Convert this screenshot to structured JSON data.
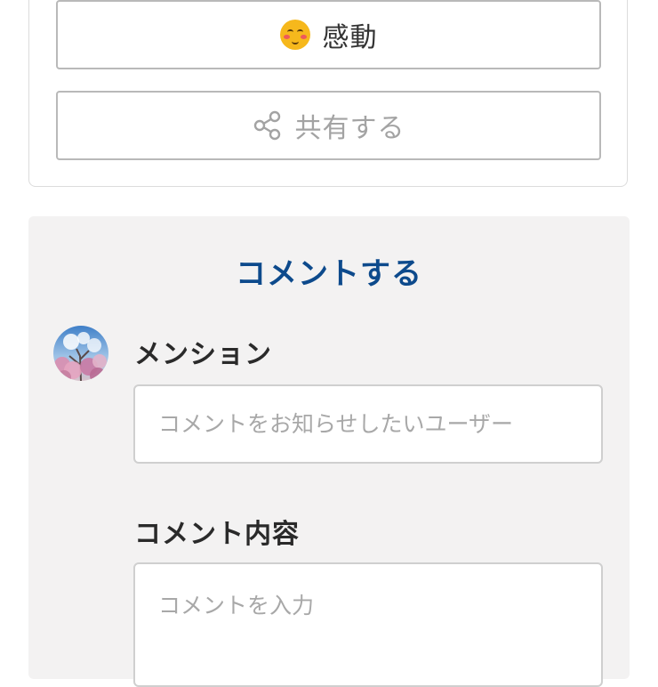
{
  "reaction_button": {
    "icon": "blushing-smile-emoji-icon",
    "label": "感動"
  },
  "share_button": {
    "icon": "share-icon",
    "label": "共有する"
  },
  "comment_section": {
    "title": "コメントする",
    "mention": {
      "label": "メンション",
      "placeholder": "コメントをお知らせしたいユーザー"
    },
    "content": {
      "label": "コメント内容",
      "placeholder": "コメントを入力"
    }
  },
  "colors": {
    "accent": "#0d4a8c",
    "panel_background": "#f3f2f2",
    "border": "#b9b9b9"
  }
}
